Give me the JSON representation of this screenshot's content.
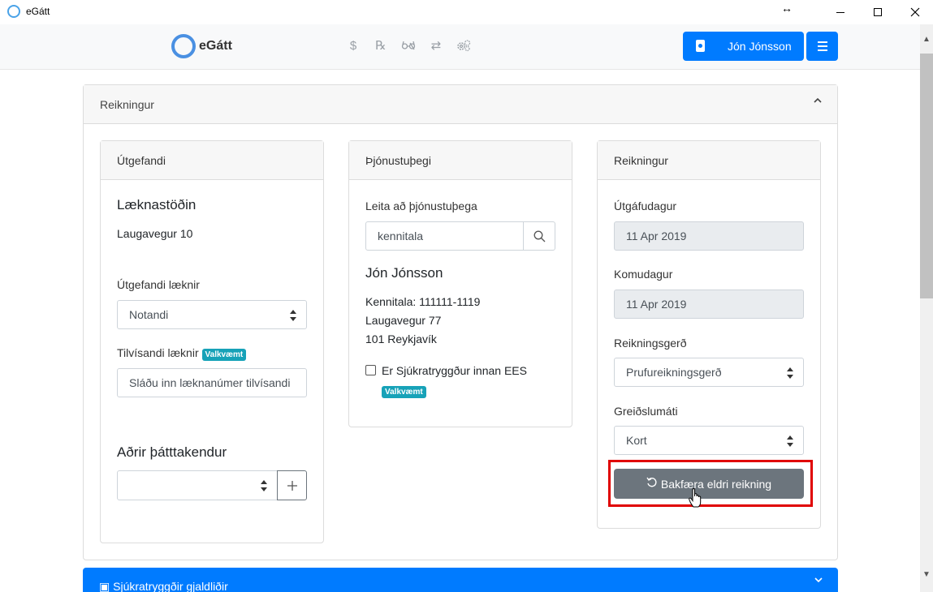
{
  "window": {
    "title": "eGátt"
  },
  "navbar": {
    "logo_text": "eGátt",
    "icons": [
      "dollar-icon",
      "prescription-icon",
      "glasses-icon",
      "exchange-icon",
      "settings-icon"
    ],
    "user_name": "Jón Jónsson"
  },
  "main": {
    "title": "Reikningur"
  },
  "issuer": {
    "header": "Útgefandi",
    "clinic_name": "Læknastöðin",
    "clinic_address": "Laugavegur 10",
    "doctor_label": "Útgefandi læknir",
    "doctor_value": "Notandi",
    "referring_label": "Tilvísandi læknir",
    "optional_badge": "Valkvæmt",
    "referring_placeholder": "Sláðu inn læknanúmer tilvísandi",
    "others_title": "Aðrir þátttakendur",
    "others_value": ""
  },
  "recipient": {
    "header": "Þjónustuþegi",
    "search_label": "Leita að þjónustuþega",
    "search_value": "kennitala",
    "name": "Jón Jónsson",
    "kennitala": "Kennitala: 111111-1119",
    "street": "Laugavegur 77",
    "city": "101 Reykjavík",
    "ees_label": "Er Sjúkratryggður innan EES",
    "optional_badge": "Valkvæmt"
  },
  "invoice": {
    "header": "Reikningur",
    "issue_date_label": "Útgáfudagur",
    "issue_date": "11 Apr 2019",
    "arrival_date_label": "Komudagur",
    "arrival_date": "11 Apr 2019",
    "type_label": "Reikningsgerð",
    "type_value": "Prufureikningsgerð",
    "payment_label": "Greiðslumáti",
    "payment_value": "Kort",
    "revert_button": "Bakfæra eldri reikning"
  },
  "bottom_section": {
    "title": "Sjúkratryggðir gjaldliðir"
  },
  "colors": {
    "primary": "#007bff",
    "secondary": "#6c757d",
    "info": "#17a2b8",
    "highlight": "#e00000"
  }
}
